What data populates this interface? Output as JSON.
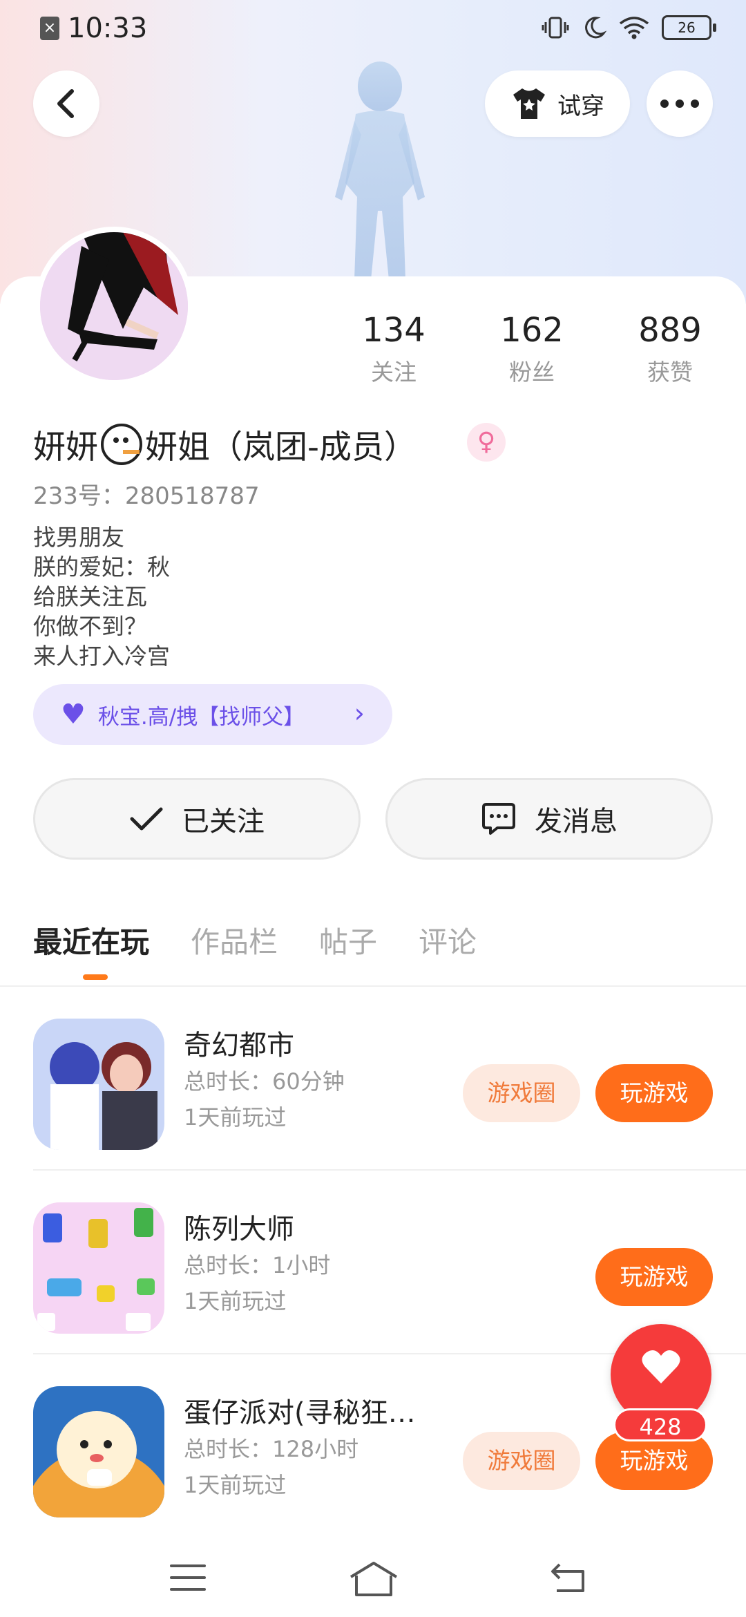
{
  "status_bar": {
    "time": "10:33",
    "battery": "26"
  },
  "header": {
    "try_on_label": "试穿"
  },
  "profile": {
    "stats": [
      {
        "value": "134",
        "label": "关注"
      },
      {
        "value": "162",
        "label": "粉丝"
      },
      {
        "value": "889",
        "label": "获赞"
      }
    ],
    "nickname_part1": "妍妍",
    "nickname_part2": "妍姐（岚团-成员）",
    "gender_icon": "♀",
    "uid": "233号：280518787",
    "bio": [
      "找男朋友",
      "朕的爱妃：秋",
      "给朕关注瓦",
      "你做不到？",
      "来人打入冷宫"
    ],
    "guild_label": "秋宝.高/拽【找师父】"
  },
  "actions": {
    "follow_label": "已关注",
    "message_label": "发消息"
  },
  "tabs": [
    {
      "label": "最近在玩",
      "active": true
    },
    {
      "label": "作品栏",
      "active": false
    },
    {
      "label": "帖子",
      "active": false
    },
    {
      "label": "评论",
      "active": false
    }
  ],
  "games": [
    {
      "name": "奇幻都市",
      "duration": "总时长：60分钟",
      "last_played": "1天前玩过",
      "circle_label": "游戏圈",
      "play_label": "玩游戏"
    },
    {
      "name": "陈列大师",
      "duration": "总时长：1小时",
      "last_played": "1天前玩过",
      "play_label": "玩游戏"
    },
    {
      "name": "蛋仔派对(寻秘狂…",
      "duration": "总时长：128小时",
      "last_played": "1天前玩过",
      "circle_label": "游戏圈",
      "play_label": "玩游戏"
    }
  ],
  "fab": {
    "count": "428"
  }
}
